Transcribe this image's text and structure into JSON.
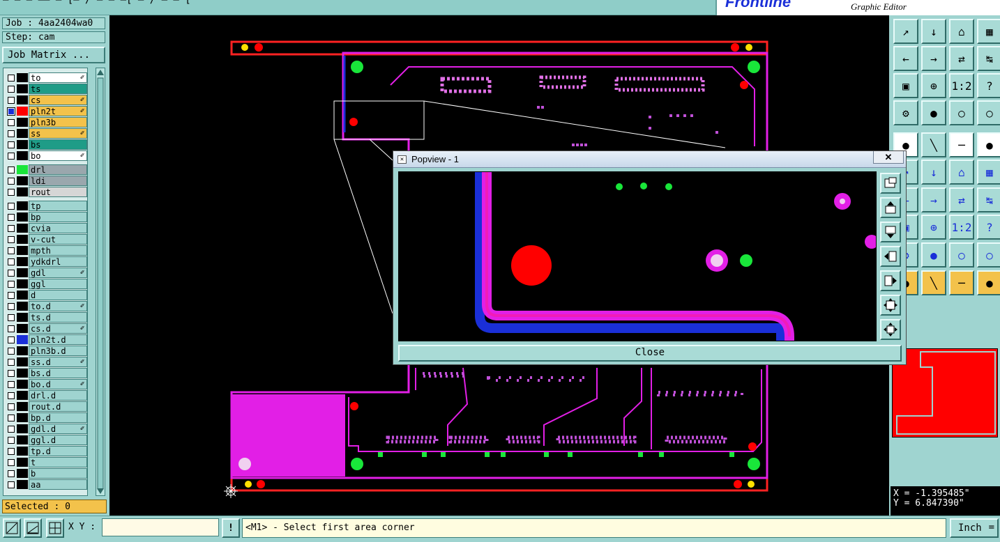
{
  "header": {
    "menu_text": "—  —  —   ——  —  [—  / —  —  —[ — / —  — [",
    "brand": "Frontline",
    "brand_sub": "Graphic Editor"
  },
  "left": {
    "job": "Job : 4aa2404wa0",
    "step": "Step: cam",
    "job_matrix": "Job Matrix ...",
    "layers": [
      {
        "name": "to",
        "bg": "#ffffff",
        "swatch": "#000000",
        "aff": true
      },
      {
        "name": "ts",
        "bg": "#1f9c87",
        "swatch": "#000000",
        "aff": false
      },
      {
        "name": "cs",
        "bg": "#f3c24b",
        "swatch": "#000000",
        "aff": true
      },
      {
        "name": "pln2t",
        "bg": "#f3c24b",
        "swatch": "#ff0000",
        "aff": true,
        "selected": true
      },
      {
        "name": "pln3b",
        "bg": "#f3c24b",
        "swatch": "#000000",
        "aff": false
      },
      {
        "name": "ss",
        "bg": "#f3c24b",
        "swatch": "#000000",
        "aff": true
      },
      {
        "name": "bs",
        "bg": "#1f9c87",
        "swatch": "#000000",
        "aff": false
      },
      {
        "name": "bo",
        "bg": "#ffffff",
        "swatch": "#000000",
        "aff": true
      },
      {
        "name": "drl",
        "bg": "#9aa7ad",
        "swatch": "#19e63a",
        "aff": false,
        "gap": true
      },
      {
        "name": "ldi",
        "bg": "#9aa7ad",
        "swatch": "#000000",
        "aff": false
      },
      {
        "name": "rout",
        "bg": "#d6d6d6",
        "swatch": "#000000",
        "aff": false
      },
      {
        "name": "tp",
        "bg": "#9fd4d0",
        "swatch": "#000000",
        "aff": false,
        "gap": true
      },
      {
        "name": "bp",
        "bg": "#9fd4d0",
        "swatch": "#000000",
        "aff": false
      },
      {
        "name": "cvia",
        "bg": "#9fd4d0",
        "swatch": "#000000",
        "aff": false
      },
      {
        "name": "v-cut",
        "bg": "#9fd4d0",
        "swatch": "#000000",
        "aff": false
      },
      {
        "name": "mpth",
        "bg": "#9fd4d0",
        "swatch": "#000000",
        "aff": false
      },
      {
        "name": "ydkdrl",
        "bg": "#9fd4d0",
        "swatch": "#000000",
        "aff": false
      },
      {
        "name": "gdl",
        "bg": "#9fd4d0",
        "swatch": "#000000",
        "aff": true
      },
      {
        "name": "ggl",
        "bg": "#9fd4d0",
        "swatch": "#000000",
        "aff": false
      },
      {
        "name": "d",
        "bg": "#9fd4d0",
        "swatch": "#000000",
        "aff": false
      },
      {
        "name": "to.d",
        "bg": "#9fd4d0",
        "swatch": "#000000",
        "aff": true
      },
      {
        "name": "ts.d",
        "bg": "#9fd4d0",
        "swatch": "#000000",
        "aff": false
      },
      {
        "name": "cs.d",
        "bg": "#9fd4d0",
        "swatch": "#000000",
        "aff": true
      },
      {
        "name": "pln2t.d",
        "bg": "#9fd4d0",
        "swatch": "#1a2fd8",
        "aff": false
      },
      {
        "name": "pln3b.d",
        "bg": "#9fd4d0",
        "swatch": "#000000",
        "aff": false
      },
      {
        "name": "ss.d",
        "bg": "#9fd4d0",
        "swatch": "#000000",
        "aff": true
      },
      {
        "name": "bs.d",
        "bg": "#9fd4d0",
        "swatch": "#000000",
        "aff": false
      },
      {
        "name": "bo.d",
        "bg": "#9fd4d0",
        "swatch": "#000000",
        "aff": true
      },
      {
        "name": "drl.d",
        "bg": "#9fd4d0",
        "swatch": "#000000",
        "aff": false
      },
      {
        "name": "rout.d",
        "bg": "#9fd4d0",
        "swatch": "#000000",
        "aff": false
      },
      {
        "name": "bp.d",
        "bg": "#9fd4d0",
        "swatch": "#000000",
        "aff": false
      },
      {
        "name": "gdl.d",
        "bg": "#9fd4d0",
        "swatch": "#000000",
        "aff": true
      },
      {
        "name": "ggl.d",
        "bg": "#9fd4d0",
        "swatch": "#000000",
        "aff": false
      },
      {
        "name": "tp.d",
        "bg": "#9fd4d0",
        "swatch": "#000000",
        "aff": false
      },
      {
        "name": "t",
        "bg": "#9fd4d0",
        "swatch": "#000000",
        "aff": false
      },
      {
        "name": "b",
        "bg": "#9fd4d0",
        "swatch": "#000000",
        "aff": false
      },
      {
        "name": "aa",
        "bg": "#9fd4d0",
        "swatch": "#000000",
        "aff": false
      }
    ],
    "selected": "Selected : 0"
  },
  "popview": {
    "title": "Popview - 1",
    "close_x": "✕",
    "close_button": "Close"
  },
  "right": {
    "coord_x": "X = -1.395485\"",
    "coord_y": "Y = 6.847390\""
  },
  "bottom": {
    "xy_label": "X Y :",
    "xy_value": "",
    "prompt": "<M1> - Select first area corner",
    "units": "Inch",
    "alert": "!"
  },
  "colors": {
    "panel": "#9fd4d0",
    "canvas": "#000000",
    "board_outline": "#ff0000",
    "trace_magenta": "#e21fe6",
    "trace_blue": "#1a2fd8",
    "pad_green": "#19e63a",
    "accent_orange": "#f3c24b"
  },
  "icons": {
    "toolbar": [
      "zoom-in-icon",
      "zoom-out-icon",
      "home-icon",
      "grid-icon",
      "pan-left-icon",
      "pan-right-icon",
      "pan-both-icon",
      "snap-icon",
      "fit-icon",
      "center-icon",
      "ratio-1-2-icon",
      "help-icon",
      "measure-icon",
      "target-icon",
      "layer-red-icon",
      "layer-red-2-icon",
      "pad-icon",
      "route-icon",
      "ruler-icon",
      "dot-icon"
    ]
  }
}
